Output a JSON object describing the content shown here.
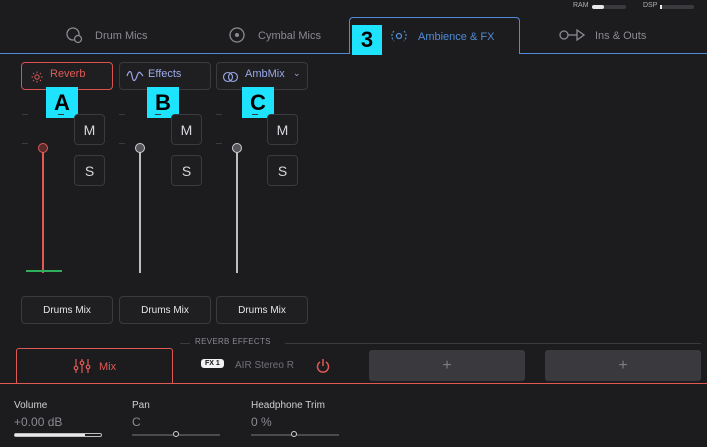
{
  "meters": {
    "ram_label": "RAM",
    "dsp_label": "DSP"
  },
  "tabs": [
    {
      "label": "Drum Mics",
      "icon": "drum-mic-icon"
    },
    {
      "label": "Cymbal Mics",
      "icon": "cymbal-icon"
    },
    {
      "label": "Ambience & FX",
      "icon": "ambience-icon",
      "active": true
    },
    {
      "label": "Ins & Outs",
      "icon": "ins-outs-icon"
    }
  ],
  "callouts": {
    "tab_number": "3",
    "a": "A",
    "b": "B",
    "c": "C"
  },
  "channels": [
    {
      "name": "Reverb",
      "icon": "reverb-sun-icon",
      "mute": "M",
      "solo": "S",
      "output": "Drums Mix",
      "accent": "#e05a55"
    },
    {
      "name": "Effects",
      "icon": "effects-wave-icon",
      "mute": "M",
      "solo": "S",
      "output": "Drums Mix"
    },
    {
      "name": "AmbMix",
      "icon": "ambmix-rings-icon",
      "mute": "M",
      "solo": "S",
      "output": "Drums Mix",
      "has_dropdown": true
    }
  ],
  "reverb_effects": {
    "section_label": "REVERB EFFECTS",
    "mix_label": "Mix",
    "fx_badge": "FX 1",
    "fx_name": "AIR Stereo R",
    "add_slot_1": "+",
    "add_slot_2": "+"
  },
  "params": {
    "volume_label": "Volume",
    "volume_value": "+0.00 dB",
    "pan_label": "Pan",
    "pan_value": "C",
    "headphone_label": "Headphone Trim",
    "headphone_value": "0 %"
  },
  "colors": {
    "accent_red": "#e05a55",
    "accent_blue": "#4f8bd6",
    "callout": "#1ee3ff",
    "background": "#1c1c1f"
  }
}
